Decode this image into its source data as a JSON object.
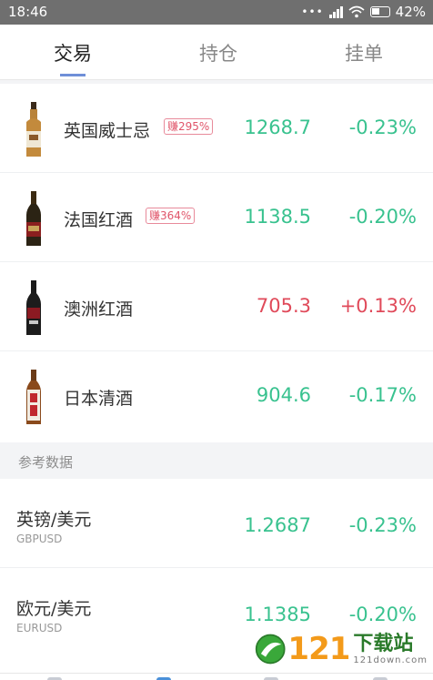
{
  "status_bar": {
    "time": "18:46",
    "battery": "42%"
  },
  "tabs": [
    {
      "label": "交易",
      "active": true
    },
    {
      "label": "持仓",
      "active": false
    },
    {
      "label": "挂单",
      "active": false
    }
  ],
  "products": [
    {
      "name": "英国威士忌",
      "badge": "赚295%",
      "price": "1268.7",
      "change": "-0.23%",
      "trend": "down",
      "icon": "whisky-bottle-icon"
    },
    {
      "name": "法国红酒",
      "badge": "赚364%",
      "price": "1138.5",
      "change": "-0.20%",
      "trend": "down",
      "icon": "wine-bottle-icon"
    },
    {
      "name": "澳洲红酒",
      "badge": "",
      "price": "705.3",
      "change": "+0.13%",
      "trend": "up",
      "icon": "wine-bottle-icon"
    },
    {
      "name": "日本清酒",
      "badge": "",
      "price": "904.6",
      "change": "-0.17%",
      "trend": "down",
      "icon": "sake-bottle-icon"
    }
  ],
  "reference": {
    "title": "参考数据",
    "items": [
      {
        "name": "英镑/美元",
        "code": "GBPUSD",
        "price": "1.2687",
        "change": "-0.23%"
      },
      {
        "name": "欧元/美元",
        "code": "EURUSD",
        "price": "1.1385",
        "change": "-0.20%"
      }
    ]
  },
  "watermark": {
    "number": "121",
    "text": "下载站",
    "url": "121down.com"
  },
  "colors": {
    "up": "#e04a5a",
    "down": "#39c28f",
    "accent": "#6f8fd8"
  }
}
